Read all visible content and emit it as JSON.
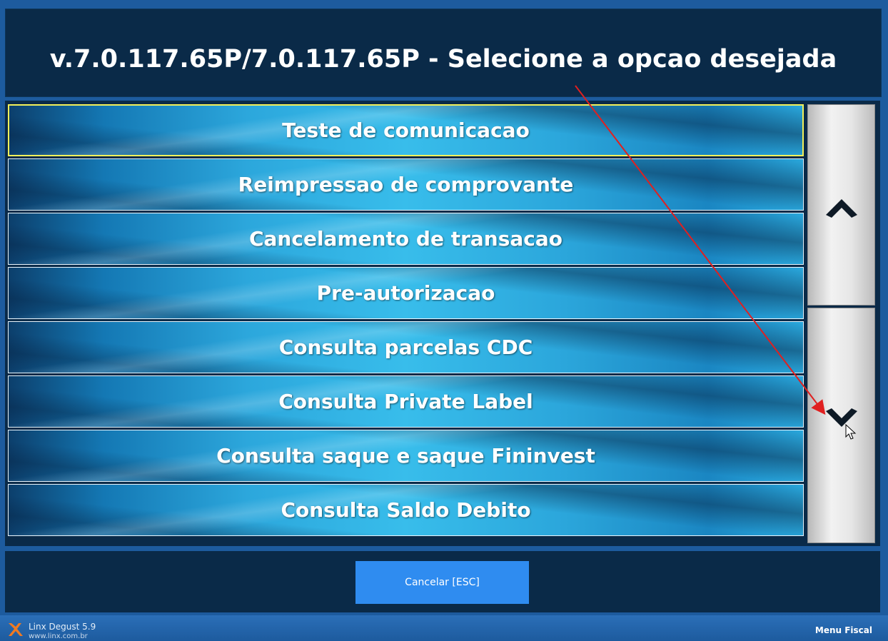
{
  "header": {
    "title": "v.7.0.117.65P/7.0.117.65P - Selecione a opcao desejada"
  },
  "menu": {
    "options": [
      {
        "label": "Teste de comunicacao",
        "selected": true
      },
      {
        "label": "Reimpressao de comprovante",
        "selected": false
      },
      {
        "label": "Cancelamento de transacao",
        "selected": false
      },
      {
        "label": "Pre-autorizacao",
        "selected": false
      },
      {
        "label": "Consulta parcelas CDC",
        "selected": false
      },
      {
        "label": "Consulta Private Label",
        "selected": false
      },
      {
        "label": "Consulta saque e saque Fininvest",
        "selected": false
      },
      {
        "label": "Consulta Saldo Debito",
        "selected": false
      }
    ],
    "scroll_up_icon": "chevron-up-icon",
    "scroll_down_icon": "chevron-down-icon"
  },
  "footer": {
    "cancel_label": "Cancelar [ESC]"
  },
  "statusbar": {
    "app_name": "Linx Degust 5.9",
    "app_url": "www.linx.com.br",
    "menu_fiscal_label": "Menu Fiscal"
  },
  "colors": {
    "background": "#1d5b9e",
    "panel": "#0a2a48",
    "option_blue": "#2ca7dc",
    "selected_border": "#f3f15a",
    "cancel_button": "#2f8cf0",
    "annotation_arrow": "#e02020"
  }
}
